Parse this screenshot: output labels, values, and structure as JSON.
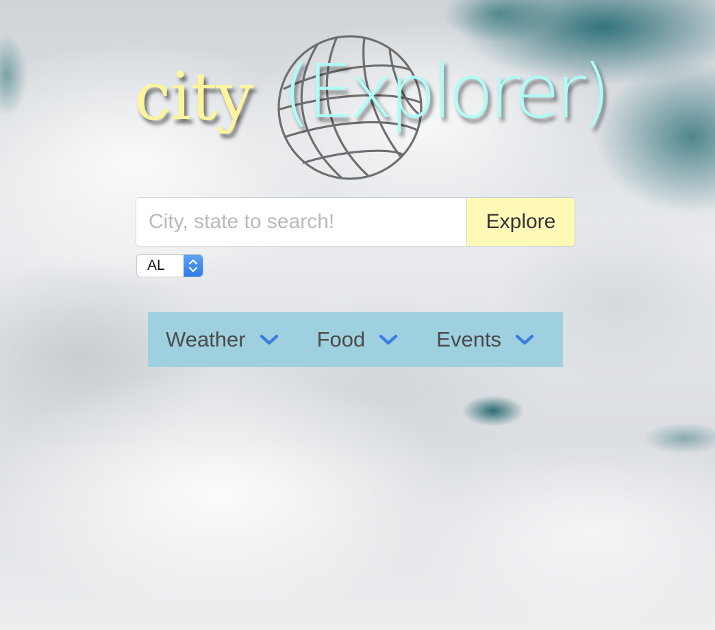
{
  "logo": {
    "city_text": "city",
    "explorer_text": "(Explorer)",
    "globe_icon": "globe-icon",
    "colors": {
      "city": "#fdf59d",
      "explorer": "#aefcf7",
      "globe": "#6e6e6e"
    }
  },
  "search": {
    "placeholder": "City, state to search!",
    "value": "",
    "button_label": "Explore",
    "button_color": "#fff9b8"
  },
  "state_select": {
    "selected": "AL",
    "arrows_icon": "select-arrows-icon",
    "accent": "#3b86ec"
  },
  "tabs": {
    "background": "#9fd0df",
    "chevron_color": "#3b7ce0",
    "items": [
      {
        "label": "Weather",
        "icon": "chevron-down-icon"
      },
      {
        "label": "Food",
        "icon": "chevron-down-icon"
      },
      {
        "label": "Events",
        "icon": "chevron-down-icon"
      }
    ]
  }
}
